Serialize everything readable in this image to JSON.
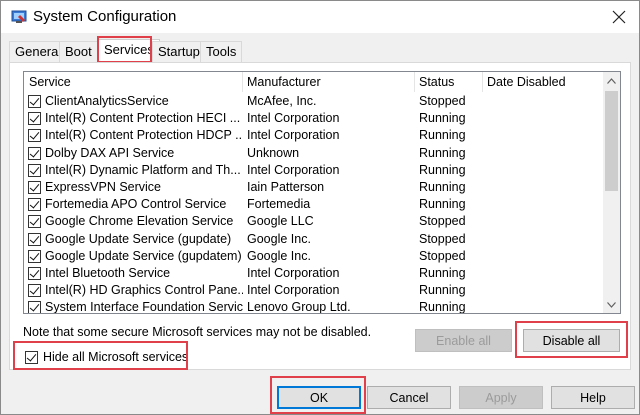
{
  "window": {
    "title": "System Configuration"
  },
  "icons": {
    "app": "system-config-icon",
    "close": "close-icon",
    "scroll_up": "chevron-up-icon",
    "scroll_down": "chevron-down-icon"
  },
  "tabs": [
    {
      "label": "General"
    },
    {
      "label": "Boot"
    },
    {
      "label": "Services",
      "active": true
    },
    {
      "label": "Startup"
    },
    {
      "label": "Tools"
    }
  ],
  "services_list": {
    "columns": [
      "Service",
      "Manufacturer",
      "Status",
      "Date Disabled"
    ],
    "rows": [
      {
        "checked": true,
        "service": "ClientAnalyticsService",
        "manufacturer": "McAfee, Inc.",
        "status": "Stopped"
      },
      {
        "checked": true,
        "service": "Intel(R) Content Protection HECI ...",
        "manufacturer": "Intel Corporation",
        "status": "Running"
      },
      {
        "checked": true,
        "service": "Intel(R) Content Protection HDCP ...",
        "manufacturer": "Intel Corporation",
        "status": "Running"
      },
      {
        "checked": true,
        "service": "Dolby DAX API Service",
        "manufacturer": "Unknown",
        "status": "Running"
      },
      {
        "checked": true,
        "service": "Intel(R) Dynamic Platform and Th...",
        "manufacturer": "Intel Corporation",
        "status": "Running"
      },
      {
        "checked": true,
        "service": "ExpressVPN Service",
        "manufacturer": "Iain Patterson",
        "status": "Running"
      },
      {
        "checked": true,
        "service": "Fortemedia APO Control Service",
        "manufacturer": "Fortemedia",
        "status": "Running"
      },
      {
        "checked": true,
        "service": "Google Chrome Elevation Service",
        "manufacturer": "Google LLC",
        "status": "Stopped"
      },
      {
        "checked": true,
        "service": "Google Update Service (gupdate)",
        "manufacturer": "Google Inc.",
        "status": "Stopped"
      },
      {
        "checked": true,
        "service": "Google Update Service (gupdatem)",
        "manufacturer": "Google Inc.",
        "status": "Stopped"
      },
      {
        "checked": true,
        "service": "Intel Bluetooth Service",
        "manufacturer": "Intel Corporation",
        "status": "Running"
      },
      {
        "checked": true,
        "service": "Intel(R) HD Graphics Control Pane...",
        "manufacturer": "Intel Corporation",
        "status": "Running"
      },
      {
        "checked": true,
        "service": "System Interface Foundation Service",
        "manufacturer": "Lenovo Group Ltd.",
        "status": "Running"
      }
    ]
  },
  "note": "Note that some secure Microsoft services may not be disabled.",
  "buttons": {
    "enable_all": "Enable all",
    "disable_all": "Disable all",
    "ok": "OK",
    "cancel": "Cancel",
    "apply": "Apply",
    "help": "Help"
  },
  "hide_ms": {
    "label": "Hide all Microsoft services",
    "checked": true
  },
  "colors": {
    "highlight": "#e0404a",
    "window_bg": "#f0f0f0"
  }
}
